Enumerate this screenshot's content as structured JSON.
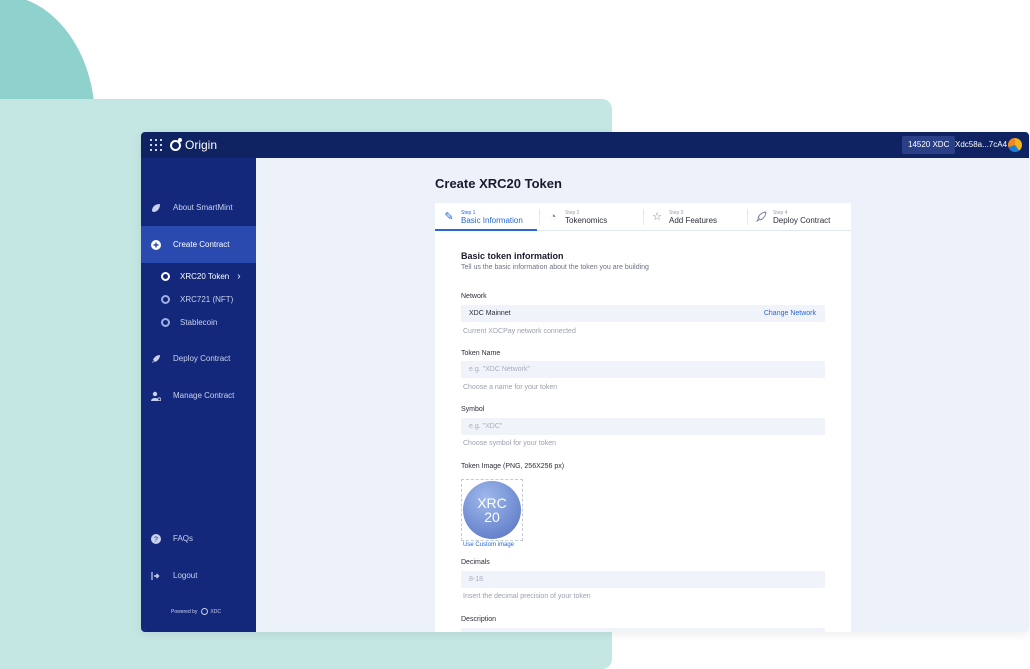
{
  "app": {
    "logo_text": "Origin",
    "balance": "14520 XDC",
    "address": "Xdc58a...7cA4"
  },
  "sidebar": {
    "items": [
      {
        "label": "About SmartMint",
        "icon": "leaf-icon"
      },
      {
        "label": "Create Contract",
        "icon": "plus-circle-icon"
      },
      {
        "label": "Deploy Contract",
        "icon": "rocket-icon"
      },
      {
        "label": "Manage Contract",
        "icon": "user-gear-icon"
      }
    ],
    "sub_items": [
      {
        "label": "XRC20 Token"
      },
      {
        "label": "XRC721 (NFT)"
      },
      {
        "label": "Stablecoin"
      }
    ],
    "faqs": "FAQs",
    "logout": "Logout",
    "powered_by": "Powered by",
    "powered_brand": "XDC"
  },
  "main": {
    "title": "Create XRC20 Token",
    "steps": [
      {
        "small": "Step 1",
        "label": "Basic Information",
        "icon": "edit-icon"
      },
      {
        "small": "Step 2",
        "label": "Tokenomics",
        "icon": "pie-chart-icon"
      },
      {
        "small": "Step 3",
        "label": "Add Features",
        "icon": "star-icon"
      },
      {
        "small": "Step 4",
        "label": "Deploy Contract",
        "icon": "rocket-icon"
      }
    ],
    "section_title": "Basic token information",
    "section_subtitle": "Tell us the basic information about the token you are building",
    "network": {
      "label": "Network",
      "value": "XDC Mainnet",
      "change": "Change Network",
      "hint": "Current XDCPay network connected"
    },
    "token_name": {
      "label": "Token Name",
      "placeholder": "e.g. \"XDC Network\"",
      "hint": "Choose a name for your token"
    },
    "symbol": {
      "label": "Symbol",
      "placeholder": "e.g. \"XDC\"",
      "hint": "Choose symbol for your token"
    },
    "token_image": {
      "label": "Token Image (PNG, 256X256 px)",
      "line1": "XRC",
      "line2": "20",
      "custom": "Use Custom image"
    },
    "decimals": {
      "label": "Decimals",
      "placeholder": "8-18",
      "hint": "Insert the decimal precision of your token"
    },
    "description": {
      "label": "Description"
    }
  },
  "colors": {
    "topbar": "#0f2363",
    "sidebar": "#13287a",
    "active": "#2b4ab0",
    "accent": "#2767d8"
  }
}
